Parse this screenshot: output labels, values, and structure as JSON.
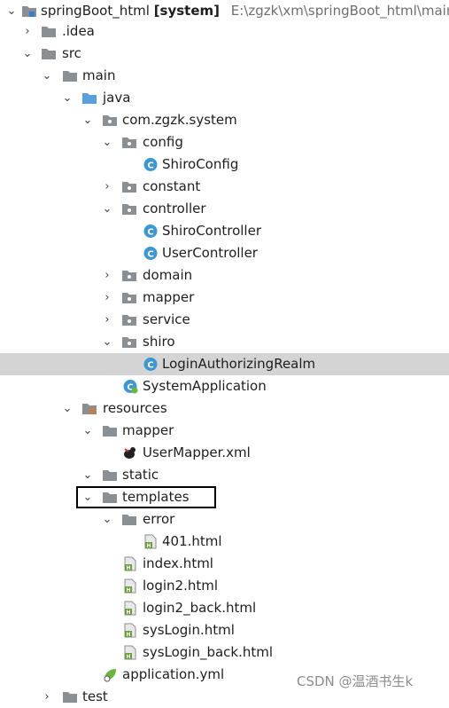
{
  "project": {
    "name": "springBoot_html",
    "module": "[system]",
    "path": "E:\\zgzk\\xm\\springBoot_html\\main\\sp"
  },
  "tree": [
    {
      "label": "springBoot_html",
      "icon": "module-folder-icon",
      "arrow": "down"
    },
    {
      "label": ".idea",
      "icon": "folder-icon",
      "arrow": "right"
    },
    {
      "label": "src",
      "icon": "folder-icon",
      "arrow": "down"
    },
    {
      "label": "main",
      "icon": "folder-icon",
      "arrow": "down"
    },
    {
      "label": "java",
      "icon": "source-folder-icon",
      "arrow": "down"
    },
    {
      "label": "com.zgzk.system",
      "icon": "package-icon",
      "arrow": "down"
    },
    {
      "label": "config",
      "icon": "package-icon",
      "arrow": "down"
    },
    {
      "label": "ShiroConfig",
      "icon": "class-icon",
      "arrow": ""
    },
    {
      "label": "constant",
      "icon": "package-icon",
      "arrow": "right"
    },
    {
      "label": "controller",
      "icon": "package-icon",
      "arrow": "down"
    },
    {
      "label": "ShiroController",
      "icon": "class-icon",
      "arrow": ""
    },
    {
      "label": "UserController",
      "icon": "class-icon",
      "arrow": ""
    },
    {
      "label": "domain",
      "icon": "package-icon",
      "arrow": "right"
    },
    {
      "label": "mapper",
      "icon": "package-icon",
      "arrow": "right"
    },
    {
      "label": "service",
      "icon": "package-icon",
      "arrow": "right"
    },
    {
      "label": "shiro",
      "icon": "package-icon",
      "arrow": "down"
    },
    {
      "label": "LoginAuthorizingRealm",
      "icon": "class-icon",
      "arrow": "",
      "selected": true
    },
    {
      "label": "SystemApplication",
      "icon": "spring-boot-class-icon",
      "arrow": ""
    },
    {
      "label": "resources",
      "icon": "resources-folder-icon",
      "arrow": "down"
    },
    {
      "label": "mapper",
      "icon": "folder-icon",
      "arrow": "down"
    },
    {
      "label": "UserMapper.xml",
      "icon": "mybatis-xml-icon",
      "arrow": ""
    },
    {
      "label": "static",
      "icon": "folder-icon",
      "arrow": "down"
    },
    {
      "label": "templates",
      "icon": "folder-icon",
      "arrow": "down",
      "boxed": true
    },
    {
      "label": "error",
      "icon": "folder-icon",
      "arrow": "down"
    },
    {
      "label": "401.html",
      "icon": "html-file-icon",
      "arrow": ""
    },
    {
      "label": "index.html",
      "icon": "html-file-icon",
      "arrow": ""
    },
    {
      "label": "login2.html",
      "icon": "html-file-icon",
      "arrow": ""
    },
    {
      "label": "login2_back.html",
      "icon": "html-file-icon",
      "arrow": ""
    },
    {
      "label": "sysLogin.html",
      "icon": "html-file-icon",
      "arrow": ""
    },
    {
      "label": "sysLogin_back.html",
      "icon": "html-file-icon",
      "arrow": ""
    },
    {
      "label": "application.yml",
      "icon": "spring-yml-icon",
      "arrow": ""
    },
    {
      "label": "test",
      "icon": "folder-icon",
      "arrow": "right"
    }
  ],
  "watermark": "CSDN @温酒书生k",
  "colors": {
    "selected_row": "#d4d4d4",
    "folder": "#8a8f94",
    "source_folder": "#5aa0dc",
    "class_icon": "#3e97d1",
    "html_icon": "#6b9e3a",
    "highlight_border": "#000000"
  }
}
